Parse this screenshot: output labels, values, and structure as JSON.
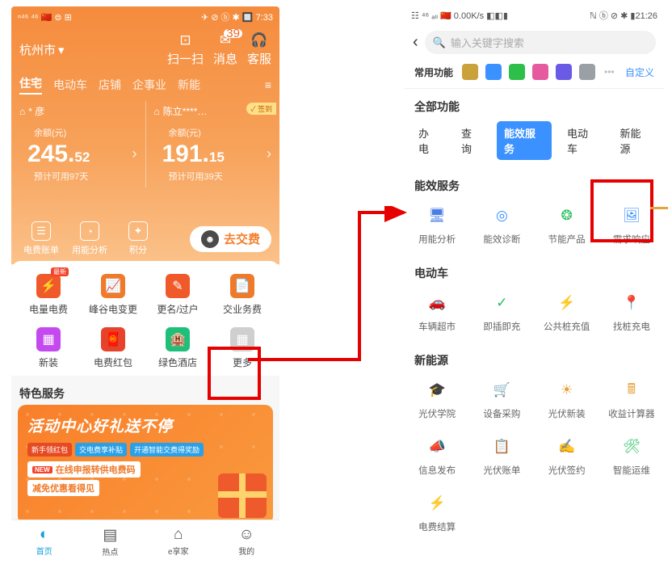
{
  "phoneA": {
    "status": {
      "left": "ⁿ⁴⁶ ⁴⁶ 🇨🇳 ⊜ ⊞",
      "right": "✈ ⊘ ⓑ ✱ 🔲 7:33"
    },
    "city": "杭州市",
    "topicons": [
      {
        "icon": "⊡",
        "label": "扫一扫"
      },
      {
        "icon": "✉",
        "label": "消息",
        "badge": "39"
      },
      {
        "icon": "🎧",
        "label": "客服"
      }
    ],
    "tabs": [
      {
        "label": "住宅",
        "active": true
      },
      {
        "label": "电动车"
      },
      {
        "label": "店铺"
      },
      {
        "label": "企事业"
      },
      {
        "label": "新能"
      }
    ],
    "cards": [
      {
        "home": "⌂",
        "name": "* 彦",
        "bal_label": "余额(元)",
        "int": "245.",
        "dec": "52",
        "days": "预计可用97天"
      },
      {
        "home": "⌂",
        "name": "陈立****…",
        "checkin": "✓ 签到",
        "bal_label": "余额(元)",
        "int": "191.",
        "dec": "15",
        "days": "预计可用39天"
      }
    ],
    "actions": [
      {
        "icon": "☰",
        "label": "电费账单"
      },
      {
        "icon": "◔",
        "label": "用能分析"
      },
      {
        "icon": "✦",
        "label": "积分"
      }
    ],
    "pay": "去交费",
    "grid": [
      {
        "color": "#f05a2a",
        "icon": "⚡",
        "label": "电量电费",
        "tag": "最新"
      },
      {
        "color": "#f07a2a",
        "icon": "📈",
        "label": "峰谷电变更"
      },
      {
        "color": "#f05a2a",
        "icon": "✎",
        "label": "更名/过户"
      },
      {
        "color": "#f07a2a",
        "icon": "📄",
        "label": "交业务费"
      },
      {
        "color": "#c44af0",
        "icon": "▦",
        "label": "新装"
      },
      {
        "color": "#e6432a",
        "icon": "🧧",
        "label": "电费红包"
      },
      {
        "color": "#1fbf7a",
        "icon": "🏨",
        "label": "绿色酒店"
      },
      {
        "color": "#cfcfcf",
        "icon": "▦",
        "label": "更多"
      }
    ],
    "special": "特色服务",
    "banner": {
      "title": "活动中心好礼送不停",
      "pills": [
        "新手领红包",
        "交电费享补贴",
        "开通智能交费得奖励"
      ],
      "new": "NEW",
      "line1": "在线申报转供电费码",
      "line2": "减免优惠看得见"
    },
    "bottom": [
      {
        "icon": "◐",
        "label": "首页",
        "active": true
      },
      {
        "icon": "▤",
        "label": "热点"
      },
      {
        "icon": "⌂",
        "label": "e享家"
      },
      {
        "icon": "☺",
        "label": "我的"
      }
    ]
  },
  "phoneB": {
    "status": {
      "left": "☷ ⁴⁶ ₐₗₗ 🇨🇳 0.00K/s ◧◧▮",
      "right": "ℕ ⓑ ⊘ ✱ ▮21:26"
    },
    "search_ph": "输入关键字搜索",
    "fav_label": "常用功能",
    "fav_icons": [
      "#c9a23b",
      "#3a91ff",
      "#2dbf4a",
      "#e65aa0",
      "#6a5ae6",
      "#9aa0a6"
    ],
    "customize": "自定义",
    "all_label": "全部功能",
    "tabs": [
      {
        "label": "办电"
      },
      {
        "label": "查询"
      },
      {
        "label": "能效服务",
        "active": true
      },
      {
        "label": "电动车"
      },
      {
        "label": "新能源"
      }
    ],
    "sections": [
      {
        "title": "能效服务",
        "items": [
          {
            "icon": "🖥",
            "color": "#4a7de6",
            "label": "用能分析"
          },
          {
            "icon": "◎",
            "color": "#3a91ff",
            "label": "能效诊断"
          },
          {
            "icon": "❂",
            "color": "#1fbf5a",
            "label": "节能产品"
          },
          {
            "icon": "🖼",
            "color": "#3a91ff",
            "label": "需求响应"
          }
        ]
      },
      {
        "title": "电动车",
        "items": [
          {
            "icon": "🚗",
            "color": "#8a5ae6",
            "label": "车辆超市"
          },
          {
            "icon": "✓",
            "color": "#1fbf5a",
            "label": "即插即充"
          },
          {
            "icon": "⚡",
            "color": "#3a91ff",
            "label": "公共桩充值"
          },
          {
            "icon": "📍",
            "color": "#1fbf5a",
            "label": "找桩充电"
          }
        ]
      },
      {
        "title": "新能源",
        "items": [
          {
            "icon": "🎓",
            "color": "#e6a23b",
            "label": "光伏学院"
          },
          {
            "icon": "🛒",
            "color": "#3a91ff",
            "label": "设备采购"
          },
          {
            "icon": "☀",
            "color": "#e6a23b",
            "label": "光伏新装"
          },
          {
            "icon": "🖩",
            "color": "#e6a23b",
            "label": "收益计算器"
          },
          {
            "icon": "📣",
            "color": "#3a91ff",
            "label": "信息发布"
          },
          {
            "icon": "📋",
            "color": "#3a91ff",
            "label": "光伏账单"
          },
          {
            "icon": "✍",
            "color": "#3a91ff",
            "label": "光伏签约"
          },
          {
            "icon": "🛠",
            "color": "#1fbf5a",
            "label": "智能运维"
          },
          {
            "icon": "⚡",
            "color": "#8bd13b",
            "label": "电费结算"
          }
        ]
      }
    ]
  }
}
